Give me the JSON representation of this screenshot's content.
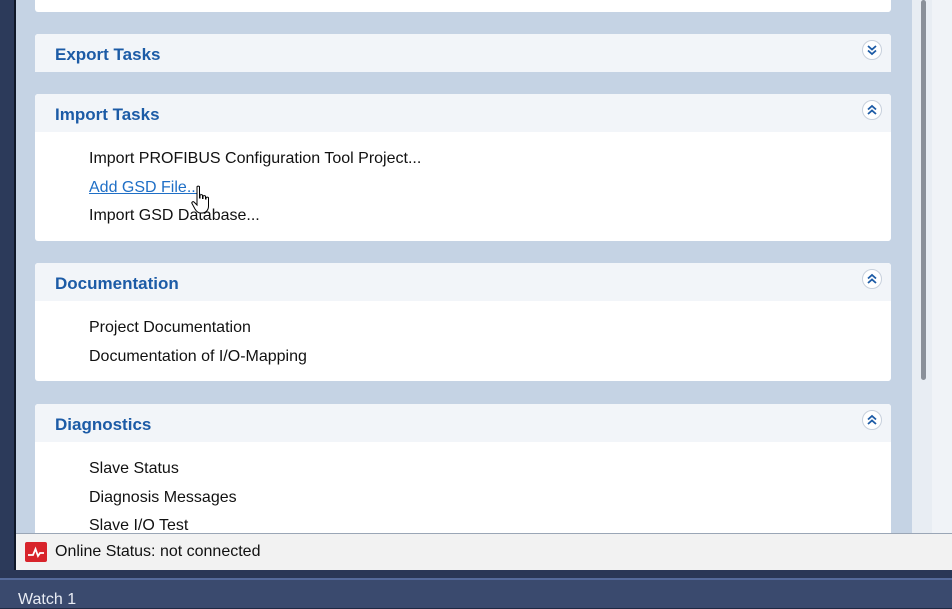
{
  "panels": {
    "export": {
      "title": "Export Tasks",
      "toggle_icon": "double-chevron-down"
    },
    "import": {
      "title": "Import Tasks",
      "toggle_icon": "double-chevron-up",
      "items": [
        "Import PROFIBUS Configuration Tool Project...",
        "Add GSD File...",
        "Import GSD Database..."
      ]
    },
    "documentation": {
      "title": "Documentation",
      "toggle_icon": "double-chevron-up",
      "items": [
        "Project Documentation",
        "Documentation of I/O-Mapping"
      ]
    },
    "diagnostics": {
      "title": "Diagnostics",
      "toggle_icon": "double-chevron-up",
      "items": [
        "Slave Status",
        "Diagnosis Messages",
        "Slave I/O Test"
      ]
    }
  },
  "status": {
    "text": "Online Status: not connected",
    "icon": "network-status-icon"
  },
  "watch": {
    "label": "Watch 1"
  },
  "colors": {
    "accent": "#1c5ba6",
    "link": "#1f6fc6",
    "background": "#c5d3e4",
    "status_icon": "#d8242b"
  }
}
